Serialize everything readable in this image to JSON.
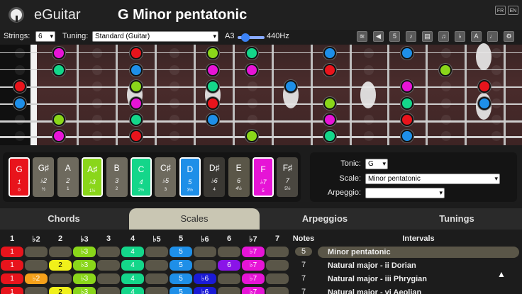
{
  "app": {
    "name": "eGuitar",
    "title": "G Minor pentatonic",
    "lang": [
      "FR",
      "EN"
    ]
  },
  "toolbar": {
    "strings_label": "Strings:",
    "strings_value": "6",
    "tuning_label": "Tuning:",
    "tuning_value": "Standard (Guitar)",
    "pitch_note": "A3",
    "pitch_freq": "440Hz",
    "icons": [
      "harp-icon",
      "speaker-icon",
      "number-5-icon",
      "notes-icon",
      "dropdown-icon",
      "clef-icon",
      "flat-icon",
      "letter-a-icon",
      "music-note-icon",
      "gear-icon"
    ]
  },
  "notes": [
    {
      "name": "G",
      "interval": "1",
      "steps": "0",
      "color": "#e8141c",
      "active": true
    },
    {
      "name": "G♯",
      "interval": "♭2",
      "steps": "½",
      "color": "#6e6a5e",
      "active": false
    },
    {
      "name": "A",
      "interval": "2",
      "steps": "1",
      "color": "#6e6a5e",
      "active": false
    },
    {
      "name": "A♯",
      "interval": "♭3",
      "steps": "1½",
      "color": "#8ad61a",
      "active": true
    },
    {
      "name": "B",
      "interval": "3",
      "steps": "2",
      "color": "#6e6a5e",
      "active": false
    },
    {
      "name": "C",
      "interval": "4",
      "steps": "2½",
      "color": "#14d68a",
      "active": true
    },
    {
      "name": "C♯",
      "interval": "♭5",
      "steps": "3",
      "color": "#6e6a5e",
      "active": false
    },
    {
      "name": "D",
      "interval": "5",
      "steps": "3½",
      "color": "#1e8fe8",
      "active": true
    },
    {
      "name": "D♯",
      "interval": "♭6",
      "steps": "4",
      "color": "#3a3833",
      "active": false
    },
    {
      "name": "E",
      "interval": "6",
      "steps": "4½",
      "color": "#5a5648",
      "active": false
    },
    {
      "name": "F",
      "interval": "♭7",
      "steps": "5",
      "color": "#e614d6",
      "active": true
    },
    {
      "name": "F♯",
      "interval": "7",
      "steps": "5½",
      "color": "#4a4740",
      "active": false
    }
  ],
  "form": {
    "tonic_label": "Tonic:",
    "tonic_value": "G",
    "scale_label": "Scale:",
    "scale_value": "Minor pentatonic",
    "arpeggio_label": "Arpeggio:",
    "arpeggio_value": ""
  },
  "tabs": [
    {
      "label": "Chords",
      "active": false
    },
    {
      "label": "Scales",
      "active": true
    },
    {
      "label": "Arpeggios",
      "active": false
    },
    {
      "label": "Tunings",
      "active": false
    }
  ],
  "table": {
    "headers": [
      "1",
      "♭2",
      "2",
      "♭3",
      "3",
      "4",
      "♭5",
      "5",
      "♭6",
      "6",
      "♭7",
      "7",
      "Notes",
      "Intervals"
    ],
    "rows": [
      {
        "cells": [
          "1",
          "",
          "",
          "♭3",
          "",
          "4",
          "",
          "5",
          "",
          "",
          "♭7",
          ""
        ],
        "notes": "5",
        "name": "Minor pentatonic",
        "selected": true
      },
      {
        "cells": [
          "1",
          "",
          "2",
          "♭3",
          "",
          "4",
          "",
          "5",
          "",
          "6",
          "♭7",
          ""
        ],
        "notes": "7",
        "name": "Natural major - ii Dorian",
        "selected": false
      },
      {
        "cells": [
          "1",
          "♭2",
          "",
          "♭3",
          "",
          "4",
          "",
          "5",
          "♭6",
          "",
          "♭7",
          ""
        ],
        "notes": "7",
        "name": "Natural major - iii Phrygian",
        "selected": false
      },
      {
        "cells": [
          "1",
          "",
          "2",
          "♭3",
          "",
          "4",
          "",
          "5",
          "♭6",
          "",
          "♭7",
          ""
        ],
        "notes": "7",
        "name": "Natural major - vi Aeolian",
        "selected": false
      }
    ]
  },
  "colors": {
    "1": "#e8141c",
    "♭2": "#f5a01a",
    "2": "#f0f01a",
    "♭3": "#8ad61a",
    "3": "#5a5648",
    "4": "#14d68a",
    "♭5": "#5a5648",
    "5": "#1e8fe8",
    "♭6": "#1a1ad6",
    "6": "#8a14e8",
    "♭7": "#e614d6",
    "7": "#5a5648",
    "empty": "#5a5648"
  }
}
